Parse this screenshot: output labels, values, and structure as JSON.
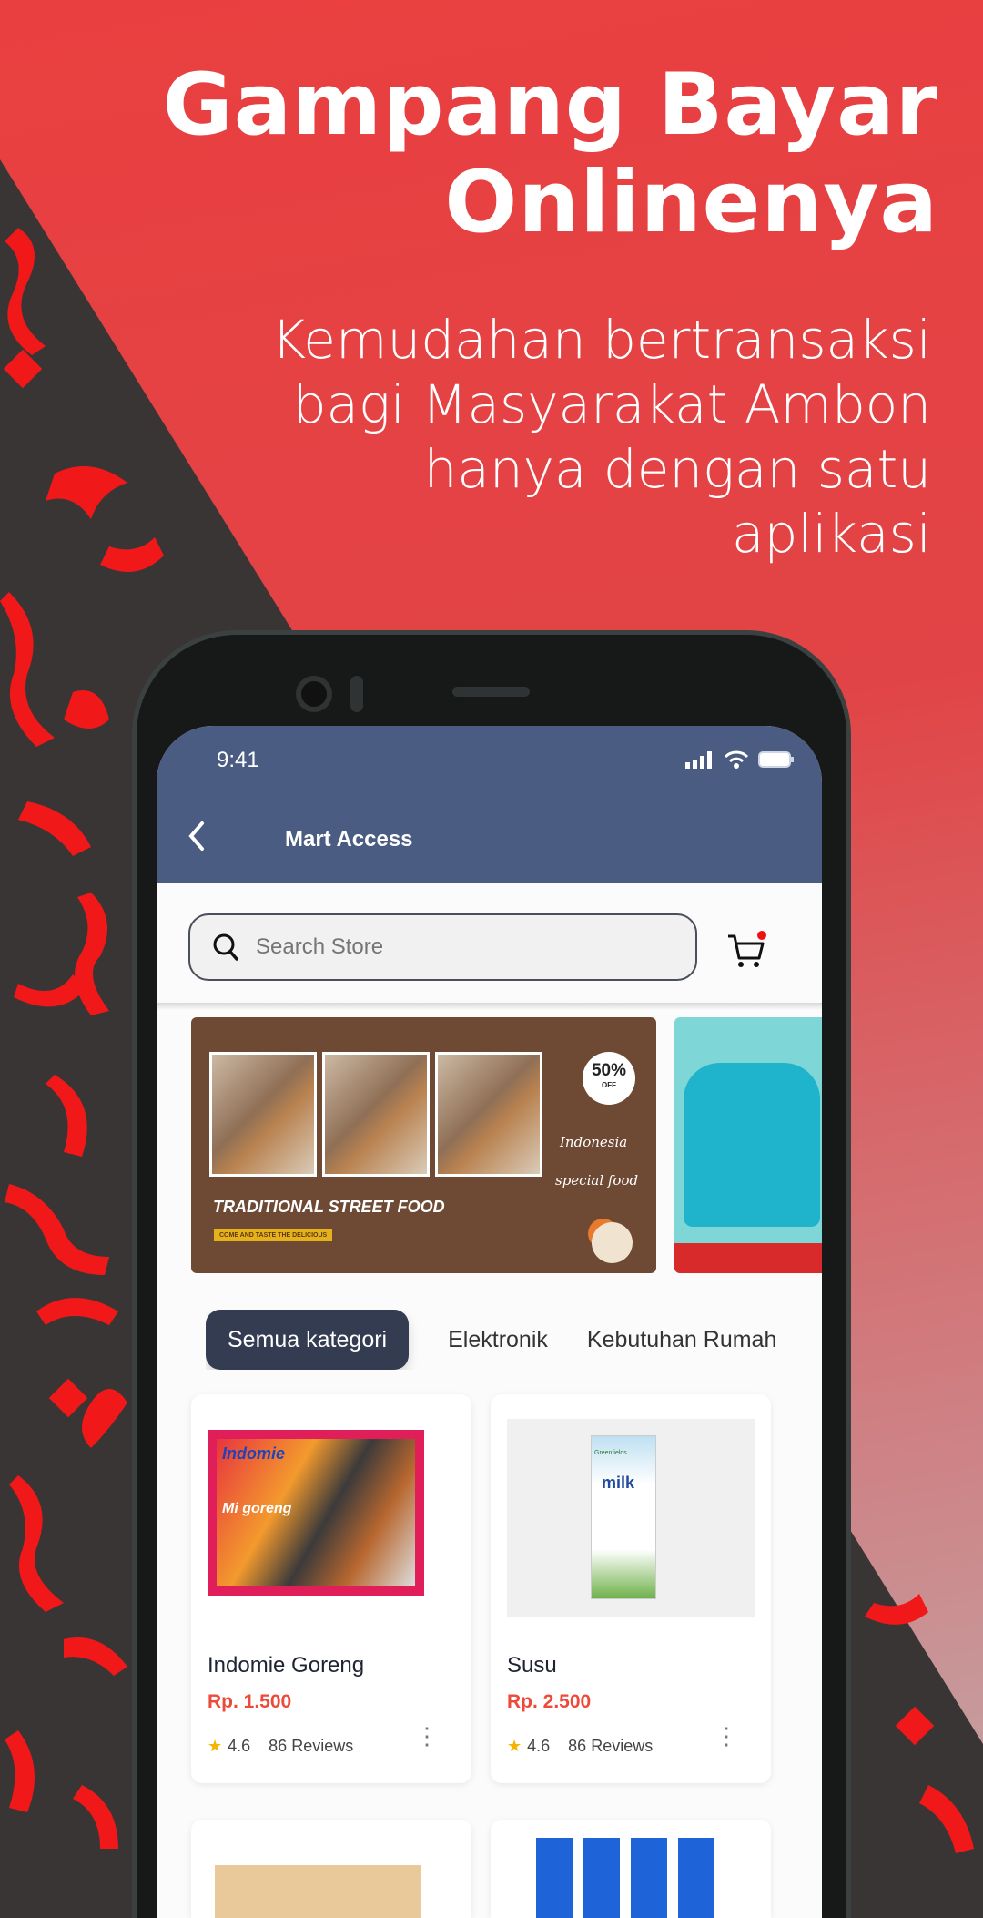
{
  "promo": {
    "headline_line1": "Gampang Bayar",
    "headline_line2": "Onlinenya",
    "sub_lines": [
      "Kemudahan bertransaksi",
      "bagi Masyarakat Ambon",
      "hanya dengan satu",
      "aplikasi"
    ]
  },
  "colors": {
    "background": "#e84040",
    "dark_band": "#3a3535",
    "header": "#4a5c82",
    "chip_active": "#343c52",
    "price": "#ee4a3a"
  },
  "status_bar": {
    "time": "9:41"
  },
  "header": {
    "title": "Mart Access",
    "back_icon": "chevron-left-icon"
  },
  "search": {
    "placeholder": "Search Store",
    "value": ""
  },
  "banners": [
    {
      "title": "TRADITIONAL STREET FOOD",
      "tag": "COME AND TASTE THE DELICIOUS",
      "badge_value": "50%",
      "badge_label": "OFF",
      "script_text1": "Indonesia",
      "script_text2": "special food"
    },
    {
      "description": "backpack"
    }
  ],
  "categories": [
    {
      "label": "Semua kategori",
      "active": true
    },
    {
      "label": "Elektronik",
      "active": false
    },
    {
      "label": "Kebutuhan Rumah",
      "active": false
    }
  ],
  "products": [
    {
      "name": "Indomie Goreng",
      "price": "Rp. 1.500",
      "rating": "4.6",
      "reviews": "86 Reviews",
      "brand_text": "Indomie",
      "pack_text": "Mi goreng"
    },
    {
      "name": "Susu",
      "price": "Rp. 2.500",
      "rating": "4.6",
      "reviews": "86 Reviews",
      "brand_text": "Greenfields",
      "pack_text": "milk"
    }
  ]
}
